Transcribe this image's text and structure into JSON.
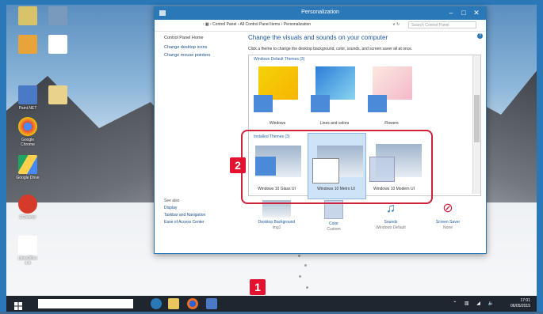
{
  "window": {
    "title": "Personalization",
    "controls": {
      "minimize": "–",
      "maximize": "□",
      "close": "✕"
    }
  },
  "address": {
    "breadcrumb": "↑  ▦ › Control Panel › All Control Panel Items › Personalization",
    "refresh": "∨ ↻",
    "search_placeholder": "Search Control Panel"
  },
  "nav": {
    "home": "Control Panel Home",
    "items": [
      "Change desktop icons",
      "Change mouse pointers"
    ]
  },
  "see_also": {
    "heading": "See also",
    "items": [
      "Display",
      "Taskbar and Navigation",
      "Ease of Access Center"
    ]
  },
  "main": {
    "heading": "Change the visuals and sounds on your computer",
    "subheading": "Click a theme to change the desktop background, color, sounds, and screen saver all at once."
  },
  "default_themes": {
    "title": "Windows Default Themes (3)",
    "items": [
      "Windows",
      "Lines and colors",
      "Flowers"
    ]
  },
  "installed_themes": {
    "title": "Installed Themes (3)",
    "items": [
      "Windows 10 Glass UI",
      "Windows 10 Metro UI",
      "Windows 10 Modern UI"
    ]
  },
  "bottom": [
    {
      "label": "Desktop Background",
      "value": "img1"
    },
    {
      "label": "Color",
      "value": "Custom"
    },
    {
      "label": "Sounds",
      "value": "Windows Default"
    },
    {
      "label": "Screen Saver",
      "value": "None"
    }
  ],
  "badges": {
    "one": "1",
    "two": "2"
  },
  "desktop_icons": [
    {
      "name": "Google Chrome",
      "label": "Google\nChrome"
    },
    {
      "name": "Google Drive",
      "label": "Google Drive"
    },
    {
      "name": "CCleaner",
      "label": "CCleaner"
    },
    {
      "name": "LibreOffice",
      "label": "LibreOffice\n4.4"
    },
    {
      "name": "Paint.NET",
      "label": "Paint.NET"
    },
    {
      "name": "Recycle Bin",
      "label": "Recycle Bin"
    }
  ],
  "taskbar": {
    "clock_time": "17:01",
    "clock_date": "06/05/2015",
    "tray": "⌃ ▥ ◢ 🔈"
  },
  "colors": {
    "accent": "#2a78b8",
    "highlight": "#d0203a",
    "badge": "#e3132f"
  }
}
